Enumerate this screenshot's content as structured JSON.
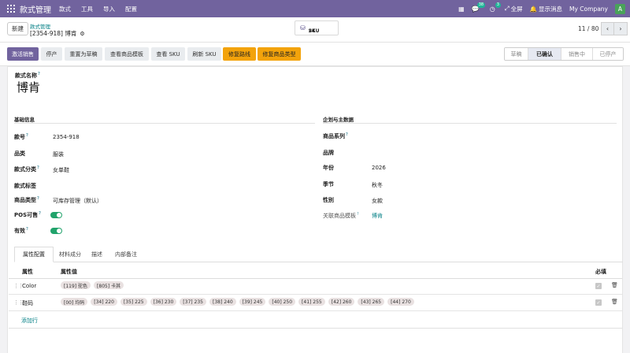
{
  "navbar": {
    "brand": "款式管理",
    "menu": [
      "款式",
      "工具",
      "导入",
      "配置"
    ],
    "chat_count": "38",
    "activity_count": "3",
    "fullscreen": "全屏",
    "show_messages": "显示消息",
    "company": "My Company",
    "avatar": "A"
  },
  "control": {
    "new_label": "新建",
    "breadcrumb_parent": "款式管理",
    "breadcrumb_current": "[2354-918] 博肯",
    "smart_label": "SKU",
    "smart_count": "24",
    "pager": "11 / 80"
  },
  "status_buttons": [
    "激活销售",
    "停产",
    "重置为草稿",
    "查看商品模板",
    "查看 SKU",
    "刷新 SKU",
    "修复路线",
    "修复商品类型"
  ],
  "stages": [
    "草稿",
    "已确认",
    "销售中",
    "已停产"
  ],
  "form": {
    "name_label": "款式名称",
    "name": "博肯",
    "section_basic": "基础信息",
    "section_plan": "企划与主数据",
    "code_label": "款号",
    "code": "2354-918",
    "category_label": "品类",
    "category": "服装",
    "style_class_label": "款式分类",
    "style_class": "女单鞋",
    "style_tag_label": "款式标签",
    "product_type_label": "商品类型",
    "product_type": "可库存管理（默认）",
    "pos_label": "POS可售",
    "active_label": "有效",
    "series_label": "商品系列",
    "brand_label": "品牌",
    "year_label": "年份",
    "year": "2026",
    "season_label": "季节",
    "season": "秋冬",
    "gender_label": "性别",
    "gender": "女款",
    "template_label": "关联商品模板",
    "template": "博肯"
  },
  "tabs": [
    "属性配置",
    "材料成分",
    "描述",
    "内部备注"
  ],
  "table": {
    "col_attr": "属性",
    "col_values": "属性值",
    "col_required": "必填",
    "rows": [
      {
        "attr": "Color",
        "values": [
          "[119] 驼色",
          "[805] 卡其"
        ]
      },
      {
        "attr": "鞋码",
        "values": [
          "[00] 均码",
          "[34] 220",
          "[35] 225",
          "[36] 230",
          "[37] 235",
          "[38] 240",
          "[39] 245",
          "[40] 250",
          "[41] 255",
          "[42] 260",
          "[43] 265",
          "[44] 270"
        ]
      }
    ],
    "add_row": "添加行"
  }
}
